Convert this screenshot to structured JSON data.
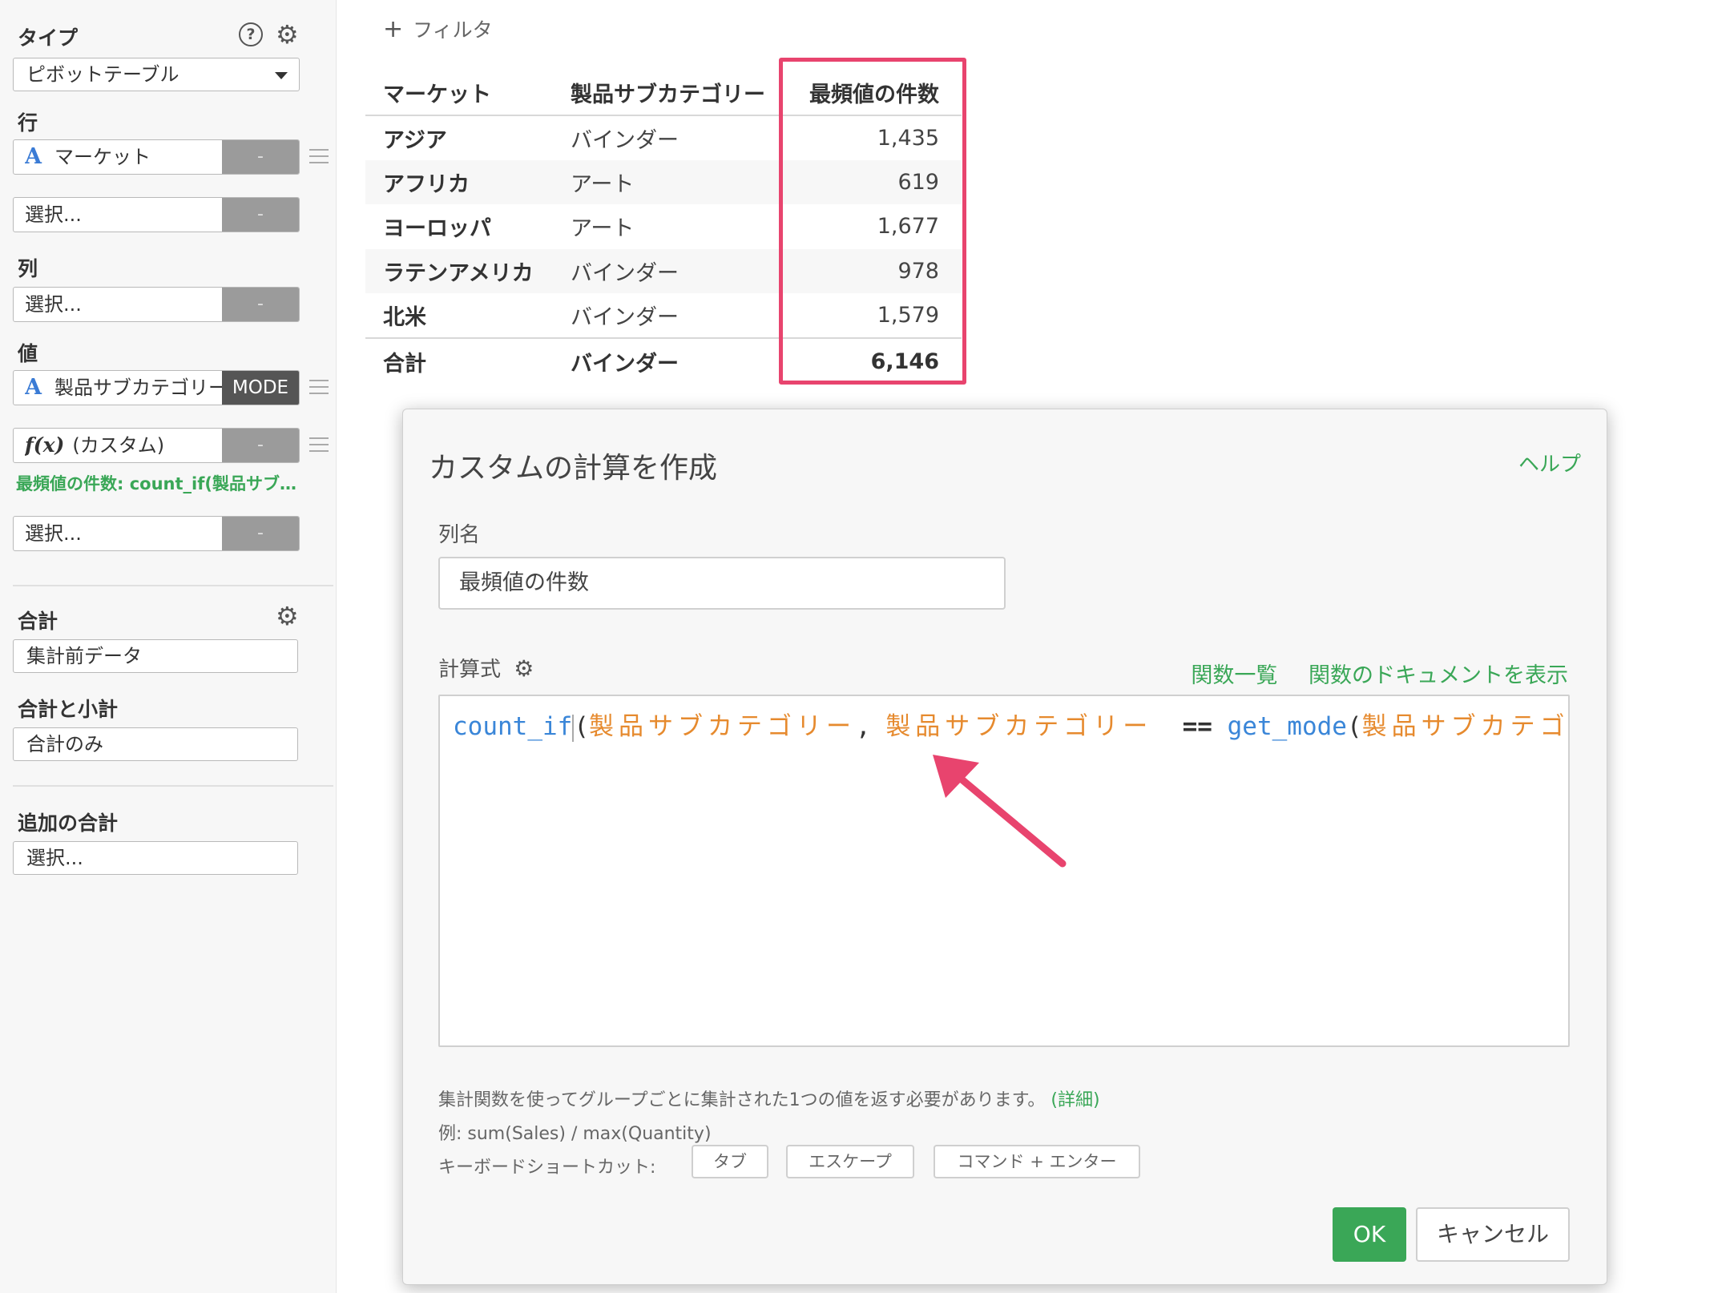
{
  "sidebar": {
    "type_label": "タイプ",
    "type_value": "ピボットテーブル",
    "rows_label": "行",
    "rows_item": "マーケット",
    "rows_select": "選択...",
    "cols_label": "列",
    "cols_select": "選択...",
    "values_label": "値",
    "values_item": "製品サブカテゴリー",
    "values_agg": "MODE",
    "custom_item": "(カスタム)",
    "custom_note": "最頻値の件数: count_if(製品サブ…",
    "values_select": "選択...",
    "minus": "-",
    "totals_label": "合計",
    "totals_value": "集計前データ",
    "subtotals_label": "合計と小計",
    "subtotals_value": "合計のみ",
    "extra_totals_label": "追加の合計",
    "extra_totals_value": "選択..."
  },
  "filter_label": "フィルタ",
  "table": {
    "headers": [
      "マーケット",
      "製品サブカテゴリー",
      "最頻値の件数"
    ],
    "rows": [
      [
        "アジア",
        "バインダー",
        "1,435"
      ],
      [
        "アフリカ",
        "アート",
        "619"
      ],
      [
        "ヨーロッパ",
        "アート",
        "1,677"
      ],
      [
        "ラテンアメリカ",
        "バインダー",
        "978"
      ],
      [
        "北米",
        "バインダー",
        "1,579"
      ]
    ],
    "total": [
      "合計",
      "バインダー",
      "6,146"
    ]
  },
  "dialog": {
    "title": "カスタムの計算を作成",
    "help": "ヘルプ",
    "col_name_label": "列名",
    "col_name_value": "最頻値の件数",
    "formula_label": "計算式",
    "fn_list": "関数一覧",
    "fn_docs": "関数のドキュメントを表示",
    "code": {
      "fn1": "count_if",
      "col1": "製品サブカテゴリー",
      "col2": "製品サブカテゴリー",
      "op": "==",
      "fn2": "get_mode",
      "col3": "製品サブカテゴ!"
    },
    "hint1": "集計関数を使ってグループごとに集計された1つの値を返す必要があります。",
    "hint1_link": "(詳細)",
    "hint2": "例: sum(Sales) / max(Quantity)",
    "kb_label": "キーボードショートカット:",
    "kb_keys": [
      "タブ",
      "エスケープ",
      "コマンド + エンター"
    ],
    "ok": "OK",
    "cancel": "キャンセル"
  },
  "colors": {
    "accent_green": "#3aa757",
    "highlight_pink": "#e8446e",
    "code_function": "#3a86d8",
    "code_column": "#e68a2e"
  }
}
